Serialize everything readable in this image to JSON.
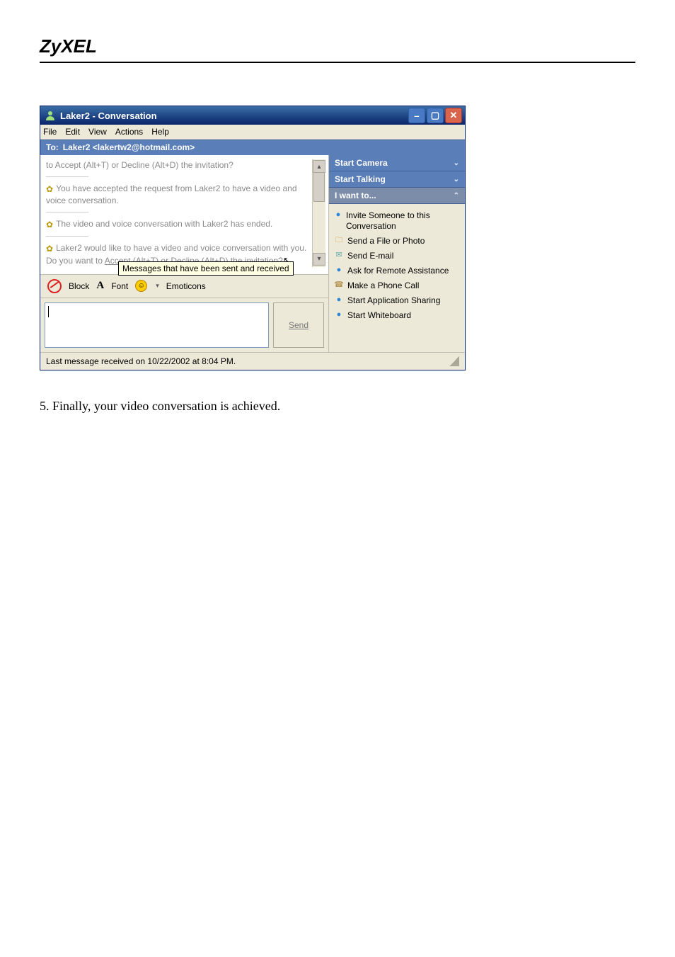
{
  "brand": "ZyXEL",
  "window": {
    "title": "Laker2 - Conversation",
    "menus": [
      "File",
      "Edit",
      "View",
      "Actions",
      "Help"
    ],
    "to_label": "To:",
    "to_address": "Laker2 <lakertw2@hotmail.com>",
    "conversation": {
      "line1": "to Accept (Alt+T) or Decline (Alt+D) the invitation?",
      "line2": "You have accepted the request from Laker2 to have a video and voice conversation.",
      "line3": "The video and voice conversation with Laker2 has ended.",
      "line4_pre": "Laker2 would like to have a video and voice conversation with you. Do you want to ",
      "accept": "Accept",
      "mid": " (Alt+T) or ",
      "decline": "Decline",
      "line4_post": " (Alt+D) the invitation?"
    },
    "callout": "Messages that have been sent and received",
    "toolbar": {
      "block": "Block",
      "font": "Font",
      "emoticons": "Emoticons"
    },
    "send": "Send",
    "side": {
      "start_camera": "Start Camera",
      "start_talking": "Start Talking",
      "i_want_to": "I want to...",
      "items": [
        "Invite Someone to this Conversation",
        "Send a File or Photo",
        "Send E-mail",
        "Ask for Remote Assistance",
        "Make a Phone Call",
        "Start Application Sharing",
        "Start Whiteboard"
      ]
    },
    "status": "Last message received on 10/22/2002 at 8:04 PM."
  },
  "body_text": "5. Finally, your video conversation is achieved."
}
